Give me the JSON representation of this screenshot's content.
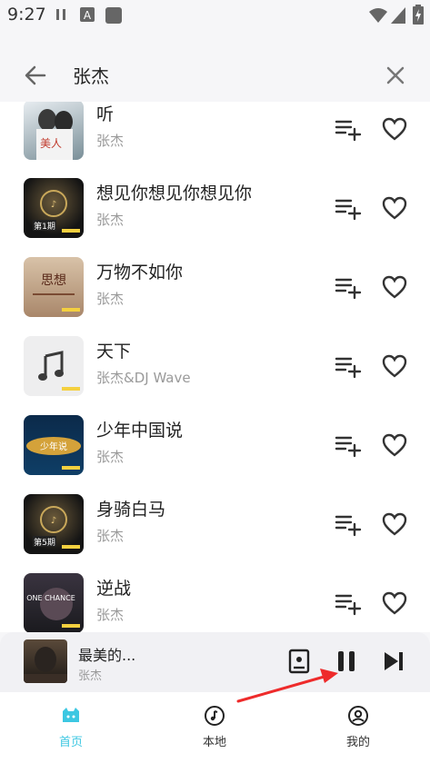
{
  "status_bar": {
    "time": "9:27"
  },
  "search": {
    "query": "张杰"
  },
  "songs": [
    {
      "title": "听",
      "artist": "张杰"
    },
    {
      "title": "想见你想见你想见你",
      "artist": "张杰"
    },
    {
      "title": "万物不如你",
      "artist": "张杰"
    },
    {
      "title": "天下",
      "artist": "张杰&DJ Wave"
    },
    {
      "title": "少年中国说",
      "artist": "张杰"
    },
    {
      "title": "身骑白马",
      "artist": "张杰"
    },
    {
      "title": "逆战",
      "artist": "张杰"
    }
  ],
  "covers": {
    "c1_text": "美人",
    "c2_text": "第1期",
    "c3_text": "思想",
    "c5_text": "少年说",
    "c6_text": "第5期",
    "c7_text": "ONE CHANCE"
  },
  "player": {
    "title": "最美的...",
    "artist": "张杰"
  },
  "nav": {
    "home": "首页",
    "local": "本地",
    "mine": "我的"
  },
  "colors": {
    "accent": "#3cc7e2",
    "annotation": "#ee2b2b"
  }
}
